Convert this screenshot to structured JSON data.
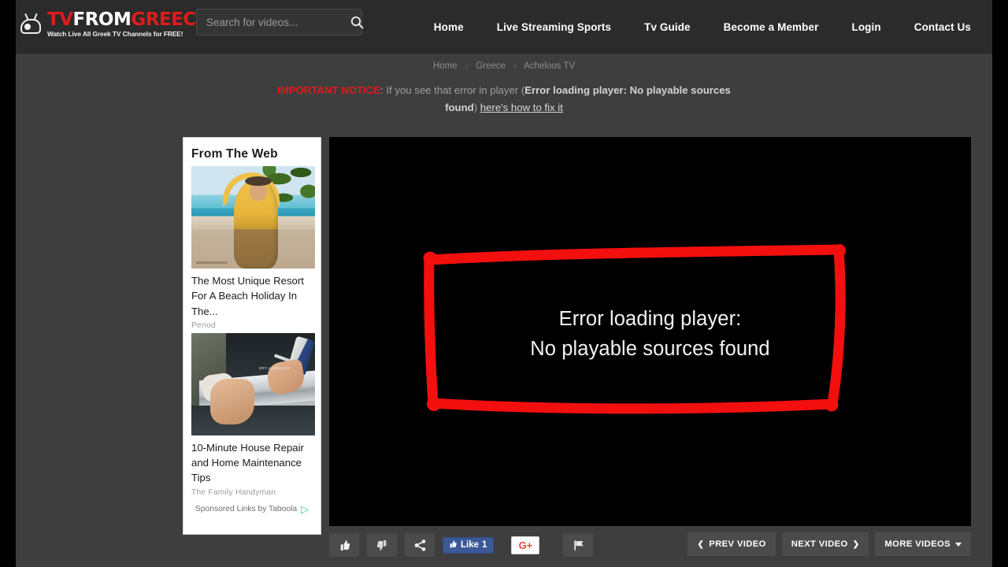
{
  "colors": {
    "brand_red": "#e01b1b",
    "page_bg": "#3e3e3e",
    "header_bg": "#2b2b2b",
    "button_bg": "#4b4b4b",
    "facebook_blue": "#3b5998",
    "google_red": "#dd4b39",
    "taboola_teal": "#3fb8b0",
    "annotation_red": "#f40f0f"
  },
  "header": {
    "logo": {
      "icon": "retro-tv-icon",
      "word1": "TV",
      "word2": "FROM",
      "word3": "GREECE",
      "tagline": "Watch Live All Greek TV Channels for FREE!"
    },
    "search": {
      "placeholder": "Search for videos...",
      "value": "",
      "icon": "search-icon"
    },
    "nav": [
      {
        "label": "Home"
      },
      {
        "label": "Live Streaming Sports"
      },
      {
        "label": "Tv Guide"
      },
      {
        "label": "Become a Member"
      },
      {
        "label": "Login"
      },
      {
        "label": "Contact Us"
      }
    ]
  },
  "breadcrumb": {
    "separator": "›",
    "items": [
      {
        "label": "Home"
      },
      {
        "label": "Greece"
      },
      {
        "label": "Acheloos TV"
      }
    ]
  },
  "notice": {
    "important": "IMPORTANT NOTICE",
    "colon": ": ",
    "text_before": "If you see that error in player (",
    "error_text": "Error loading player: No playable sources found",
    "text_after": ") ",
    "link": "here's how to fix it"
  },
  "sidebar": {
    "title": "From The Web",
    "items": [
      {
        "thumb": "beach-resort-photo",
        "title": "The Most Unique Resort For A Beach Holiday In The...",
        "brand": "Period"
      },
      {
        "thumb": "window-repair-photo",
        "title": "10-Minute House Repair and Home Maintenance Tips",
        "brand": "The Family Handyman",
        "thumb_label": "DRY LUBRICANT"
      }
    ],
    "footer": {
      "label": "Sponsored Links by Taboola",
      "mark": "▷"
    }
  },
  "player": {
    "error_line1": "Error loading player:",
    "error_line2": "No playable sources found",
    "annotation": "red-hand-drawn-rectangle"
  },
  "toolbar": {
    "like_icon": "thumbs-up-icon",
    "dislike_icon": "thumbs-down-icon",
    "share_icon": "share-icon",
    "report_icon": "flag-icon",
    "facebook": {
      "icon": "facebook-thumb-icon",
      "label": "Like",
      "count": "1"
    },
    "google_plus": {
      "label": "G+"
    },
    "prev": {
      "label": "PREV VIDEO",
      "icon": "chevron-left-icon"
    },
    "next": {
      "label": "NEXT VIDEO",
      "icon": "chevron-right-icon"
    },
    "more": {
      "label": "MORE VIDEOS",
      "icon": "caret-down-icon"
    }
  }
}
